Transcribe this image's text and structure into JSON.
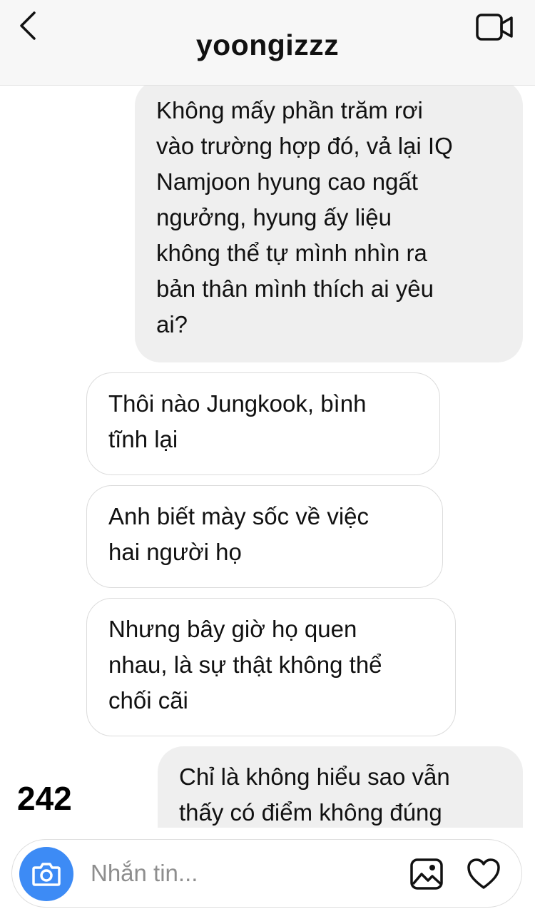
{
  "header": {
    "title": "yoongizzz",
    "back_icon": "chevron-left-icon",
    "video_icon": "video-camera-icon"
  },
  "messages": [
    {
      "direction": "sent",
      "text": "Không mấy phần trăm rơi\nvào trường hợp đó, vả lại IQ\nNamjoon hyung cao ngất\nngưởng, hyung ấy liệu\nkhông thể tự mình nhìn ra\nbản thân mình thích ai yêu\nai?"
    },
    {
      "direction": "received",
      "text": "Thôi nào Jungkook, bình\ntĩnh lại"
    },
    {
      "direction": "received",
      "text": "Anh biết mày sốc về việc\nhai người họ"
    },
    {
      "direction": "received",
      "text": "Nhưng bây giờ họ quen\nnhau, là sự thật không thể\nchối cãi"
    },
    {
      "direction": "sent",
      "text": "Chỉ là không hiểu sao vẫn\nthấy có điểm không đúng"
    }
  ],
  "page_number": "242",
  "composer": {
    "placeholder": "Nhắn tin...",
    "value": "",
    "camera_icon": "camera-icon",
    "gallery_icon": "image-gallery-icon",
    "heart_icon": "heart-icon"
  },
  "colors": {
    "sent_bubble": "#efefef",
    "received_bubble_border": "#dcdcdc",
    "camera_button": "#3d8bf5",
    "header_background": "#f7f7f7"
  }
}
